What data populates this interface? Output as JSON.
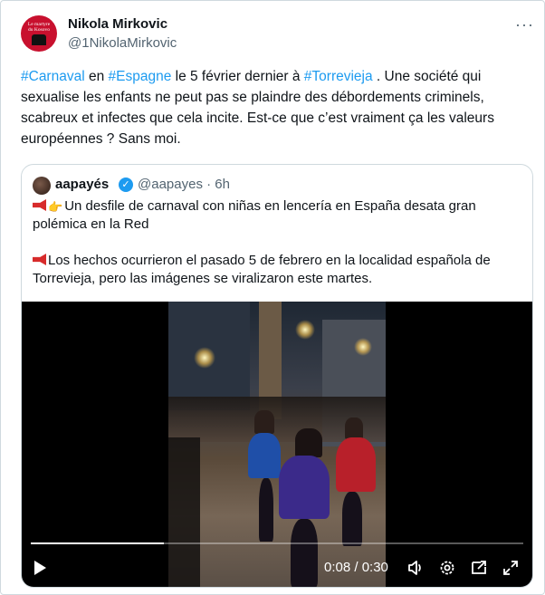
{
  "author": {
    "name": "Nikola Mirkovic",
    "handle": "@1NikolaMirkovic",
    "avatar_text": "Le martyre du Kosovo"
  },
  "more_label": "···",
  "tweet": {
    "hashtag1": "#Carnaval",
    "t1": " en ",
    "hashtag2": "#Espagne",
    "t2": " le 5 février dernier à ",
    "hashtag3": "#Torrevieja",
    "t3": " . Une société qui sexualise les enfants ne peut pas se plaindre des débordements criminels, scabreux et infectes que cela incite. Est-ce que c’est vraiment ça les valeurs européennes ? Sans moi."
  },
  "quote": {
    "name": "aapayés",
    "verified_mark": "✓",
    "handle_time": "@aapayes · 6h",
    "para1": "Un desfile de carnaval con niñas en lencería en España desata gran polémica en la Red",
    "para2": "Los hechos ocurrieron el pasado 5 de febrero en la localidad española de Torrevieja, pero las imágenes se viralizaron este martes."
  },
  "video": {
    "time": "0:08 / 0:30",
    "progress": 0.27
  },
  "icons": {
    "play": "play-icon",
    "volume": "volume-icon",
    "settings": "gear-icon",
    "pip": "picture-in-picture-icon",
    "fullscreen": "fullscreen-icon"
  },
  "colors": {
    "link": "#1d9bf0",
    "text": "#0f1419",
    "secondary": "#536471",
    "border": "#cfd9de"
  }
}
